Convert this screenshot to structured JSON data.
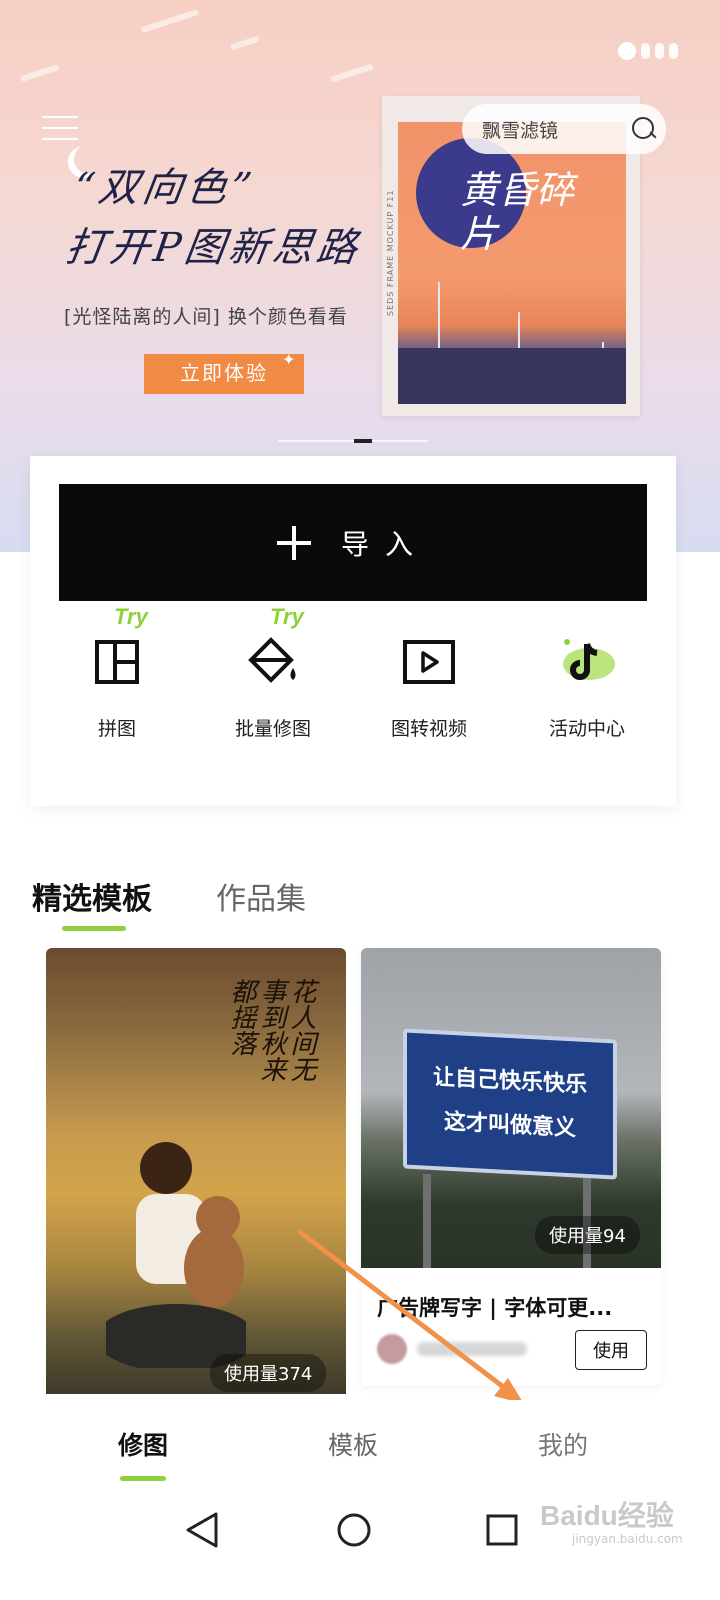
{
  "banner": {
    "headline_line1": "“双向色”",
    "headline_line2": "打开P图新思路",
    "subline": "[光怪陆离的人间] 换个颜色看看",
    "cta": "立即体验",
    "poster_title": "黄昏碎片",
    "poster_side_text": "SEDS FRAME MOCKUP F11"
  },
  "search": {
    "placeholder": "飘雪滤镜"
  },
  "import_button": {
    "label": "导入"
  },
  "tools": [
    {
      "label": "拼图",
      "badge": "Try",
      "icon": "grid-layout-icon"
    },
    {
      "label": "批量修图",
      "badge": "Try",
      "icon": "paint-bucket-icon"
    },
    {
      "label": "图转视频",
      "badge": "",
      "icon": "video-play-icon"
    },
    {
      "label": "活动中心",
      "badge": "",
      "icon": "tiktok-icon"
    }
  ],
  "section_tabs": {
    "active": "精选模板",
    "inactive": "作品集"
  },
  "templates": [
    {
      "usage": "使用量374",
      "poem": "花人间无事到秋来都摇落"
    },
    {
      "usage": "使用量94",
      "sign_line1": "让自己快乐快乐",
      "sign_line2": "这才叫做意义",
      "title": "广告牌写字 | 字体可更...",
      "use_label": "使用"
    }
  ],
  "bottom_nav": [
    "修图",
    "模板",
    "我的"
  ],
  "watermark": {
    "brand": "Baidu经验",
    "url": "jingyan.baidu.com"
  },
  "colors": {
    "accent_green": "#8ed13a",
    "cta_orange": "#f08a45",
    "annotation_arrow": "#f0924a"
  }
}
